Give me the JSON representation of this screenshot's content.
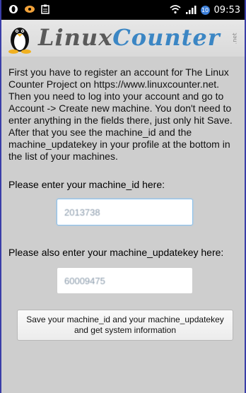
{
  "status_bar": {
    "time": "09:53",
    "notification_badge": "10",
    "icons": [
      "opera-icon",
      "ubuntu-icon",
      "clipboard-icon",
      "wifi-icon",
      "signal-icon"
    ]
  },
  "header": {
    "logo_part1": "Linux",
    "logo_part2": "Counter",
    "logo_suffix": ".net",
    "icon": "tux-penguin-icon"
  },
  "main": {
    "instructions": "First you have to register an account for The Linux Counter Project on https://www.linuxcounter.net. Then you need to log into your account and go to Account -> Create new machine. You don't need to enter anything in the fields there, just only hit Save. After that you see the machine_id and the machine_updatekey in your profile at the bottom in the list of your machines.",
    "machine_id_label": "Please enter your machine_id here:",
    "machine_id_value": "2013738",
    "updatekey_label": "Please also enter your machine_updatekey here:",
    "updatekey_value": "60009475",
    "submit_label": "Save your machine_id and your machine_updatekey and get system information"
  },
  "colors": {
    "background": "#cecece",
    "status_bar": "#000000",
    "accent_blue": "#3b86c4",
    "logo_gray": "#5a5a5a",
    "frame": "#3a3ea8"
  }
}
